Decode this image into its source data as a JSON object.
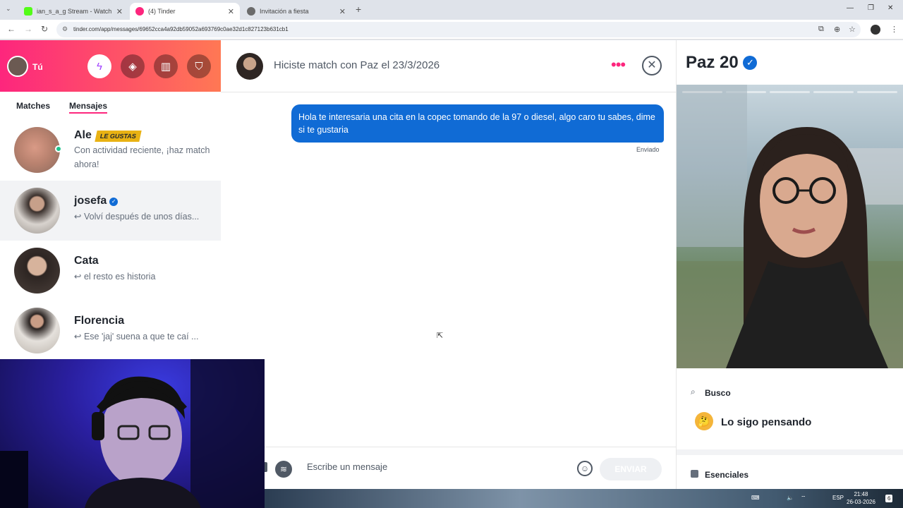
{
  "browser": {
    "tabs": [
      {
        "title": "ian_s_a_g Stream - Watch Live o",
        "favicon_color": "#53fc18"
      },
      {
        "title": "(4) Tinder",
        "favicon_color": "#fd267d"
      },
      {
        "title": "Invitación a fiesta",
        "favicon_color": "#6b6b6b"
      }
    ],
    "new_tab": "+",
    "url": "tinder.com/app/messages/69652cca4a92db59052a693769c0ae32d1c827123b631cb1"
  },
  "sidebar": {
    "me_label": "Tú",
    "tabs": {
      "matches": "Matches",
      "messages": "Mensajes"
    },
    "conversations": [
      {
        "name": "Ale",
        "badge": "LE GUSTAS",
        "message": "Con actividad reciente, ¡haz match ahora!",
        "online": true
      },
      {
        "name": "josefa",
        "verified": true,
        "reply_icon": "↩",
        "message": "Volví después de unos días..."
      },
      {
        "name": "Cata",
        "reply_icon": "↩",
        "message": "el resto es historia"
      },
      {
        "name": "Florencia",
        "reply_icon": "↩",
        "message": "Ese 'jaj' suena a que te caí ..."
      }
    ]
  },
  "chat": {
    "header_title": "Hiciste match con Paz el 23/3/2026",
    "messages": [
      {
        "text": "Hola te interesaria una cita en la copec tomando de la 97 o diesel, algo caro tu sabes, dime si te gustaria",
        "status": "Enviado"
      }
    ],
    "input_placeholder": "Escribe un mensaje",
    "send_label": "ENVIAR"
  },
  "profile": {
    "name": "Paz",
    "age": "20",
    "photo_count": 5,
    "current_photo": 1,
    "looking_title": "Busco",
    "looking_value": "Lo sigo pensando",
    "essentials_title": "Esenciales"
  },
  "taskbar": {
    "lang": "ESP",
    "time": "21:48",
    "date": "26-03-2026",
    "notifications": "6"
  },
  "colors": {
    "brand_gradient_start": "#fd267d",
    "brand_gradient_end": "#ff7854",
    "bubble_blue": "#106bd5",
    "badge_gold": "#e9b213"
  }
}
